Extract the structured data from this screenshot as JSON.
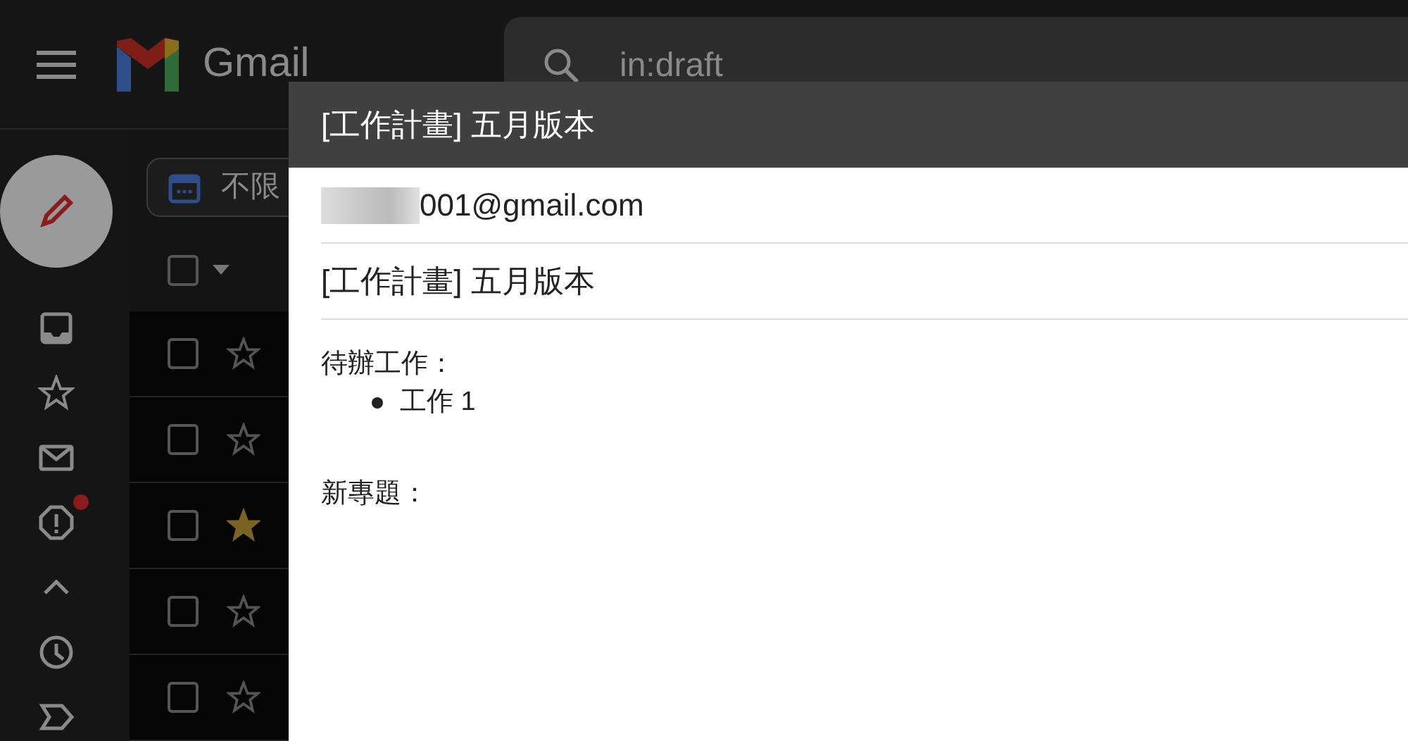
{
  "header": {
    "app_name": "Gmail",
    "search": {
      "value": "in:draft"
    }
  },
  "date_filter": {
    "label": "不限"
  },
  "sidebar": {
    "items": [
      {
        "kind": "inbox",
        "badge": false
      },
      {
        "kind": "starred",
        "badge": false
      },
      {
        "kind": "mail",
        "badge": false
      },
      {
        "kind": "spam",
        "badge": true
      },
      {
        "kind": "less",
        "badge": false
      },
      {
        "kind": "snoozed",
        "badge": false
      },
      {
        "kind": "label",
        "badge": false
      }
    ]
  },
  "message_list": {
    "select_all": {
      "checked": false
    },
    "rows": [
      {
        "checked": false,
        "starred": false
      },
      {
        "checked": false,
        "starred": false
      },
      {
        "checked": false,
        "starred": true
      },
      {
        "checked": false,
        "starred": false
      },
      {
        "checked": false,
        "starred": false
      }
    ]
  },
  "compose": {
    "title": "[工作計畫] 五月版本",
    "to": "001@gmail.com",
    "subject": "[工作計畫] 五月版本",
    "body": [
      {
        "kind": "paragraph",
        "text": "待辦工作："
      },
      {
        "kind": "bullet",
        "text": "工作 1"
      },
      {
        "kind": "gap"
      },
      {
        "kind": "paragraph",
        "text": "新專題："
      }
    ]
  }
}
